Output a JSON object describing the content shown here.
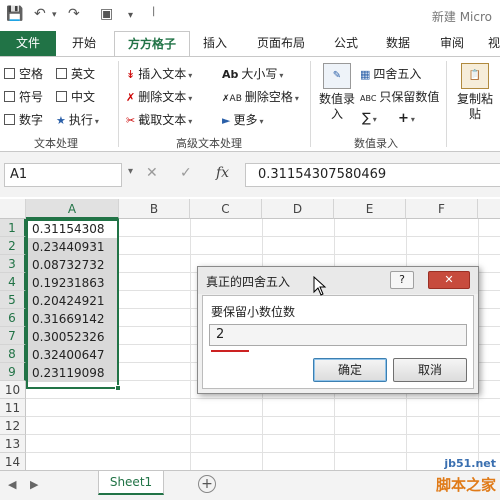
{
  "window": {
    "title": "新建 Micro"
  },
  "tabs": [
    "文件",
    "开始",
    "方方格子",
    "插入",
    "页面布局",
    "公式",
    "数据",
    "审阅",
    "视"
  ],
  "ribbon": {
    "text_group": {
      "checkboxes": [
        "空格",
        "英文",
        "符号",
        "中文",
        "数字"
      ],
      "execute": "执行",
      "label": "文本处理"
    },
    "advanced_group": {
      "insert_text": "插入文本",
      "delete_text": "删除文本",
      "extract_text": "截取文本",
      "case": "大小写",
      "delete_spaces": "删除空格",
      "more": "更多",
      "label": "高级文本处理"
    },
    "number_group": {
      "value_entry": "数值录入",
      "round": "四舍五入",
      "keep_values": "只保留数值",
      "label": "数值录入"
    },
    "copy_paste": "复制粘贴"
  },
  "formula_bar": {
    "name_box": "A1",
    "fx": "fx",
    "value": "0.31154307580469"
  },
  "columns": [
    "A",
    "B",
    "C",
    "D",
    "E",
    "F"
  ],
  "rows": [
    "1",
    "2",
    "3",
    "4",
    "5",
    "6",
    "7",
    "8",
    "9",
    "10",
    "11",
    "12",
    "13",
    "14"
  ],
  "cells_A": [
    "0.31154308",
    "0.23440931",
    "0.08732732",
    "0.19231863",
    "0.20424921",
    "0.31669142",
    "0.30052326",
    "0.32400647",
    "0.23119098"
  ],
  "dialog": {
    "title": "真正的四舍五入",
    "help": "?",
    "close": "✕",
    "label": "要保留小数位数",
    "input_value": "2",
    "ok": "确定",
    "cancel": "取消"
  },
  "sheet_tab": "Sheet1",
  "watermark": {
    "site": "jb51.net",
    "name": "脚本之家"
  },
  "accent_color": "#217346"
}
